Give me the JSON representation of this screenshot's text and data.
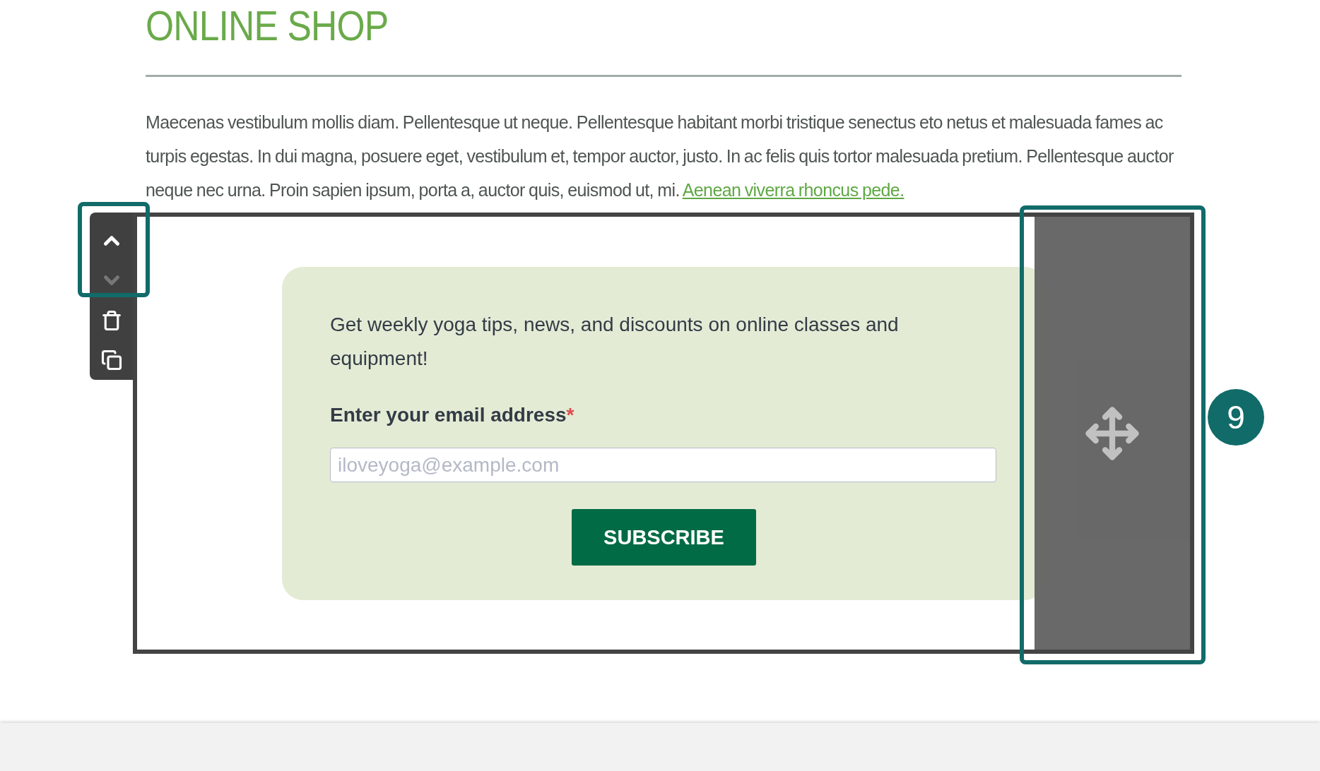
{
  "heading": "ONLINE SHOP",
  "intro": {
    "text": "Maecenas vestibulum mollis diam. Pellentesque ut neque. Pellentesque habitant morbi tristique senectus eto netus et malesuada fames ac turpis egestas. In dui magna, posuere eget, vestibulum et, tempor auctor, justo. In ac felis quis tortor malesuada pretium. Pellentesque auctor neque nec urna. Proin sapien ipsum, porta a, auctor quis, euismod ut, mi.",
    "link": "Aenean viverra rhoncus pede."
  },
  "block_toolbar": [
    {
      "kind": "up",
      "disabled": false
    },
    {
      "kind": "down",
      "disabled": true
    },
    {
      "kind": "delete",
      "disabled": false
    },
    {
      "kind": "duplicate",
      "disabled": false
    }
  ],
  "signup": {
    "text": "Get weekly yoga tips, news, and discounts on online classes and equipment!",
    "label": "Enter your email address",
    "required_mark": "*",
    "placeholder": "iloveyoga@example.com",
    "button": "SUBSCRIBE"
  },
  "callout": {
    "number": "9"
  }
}
